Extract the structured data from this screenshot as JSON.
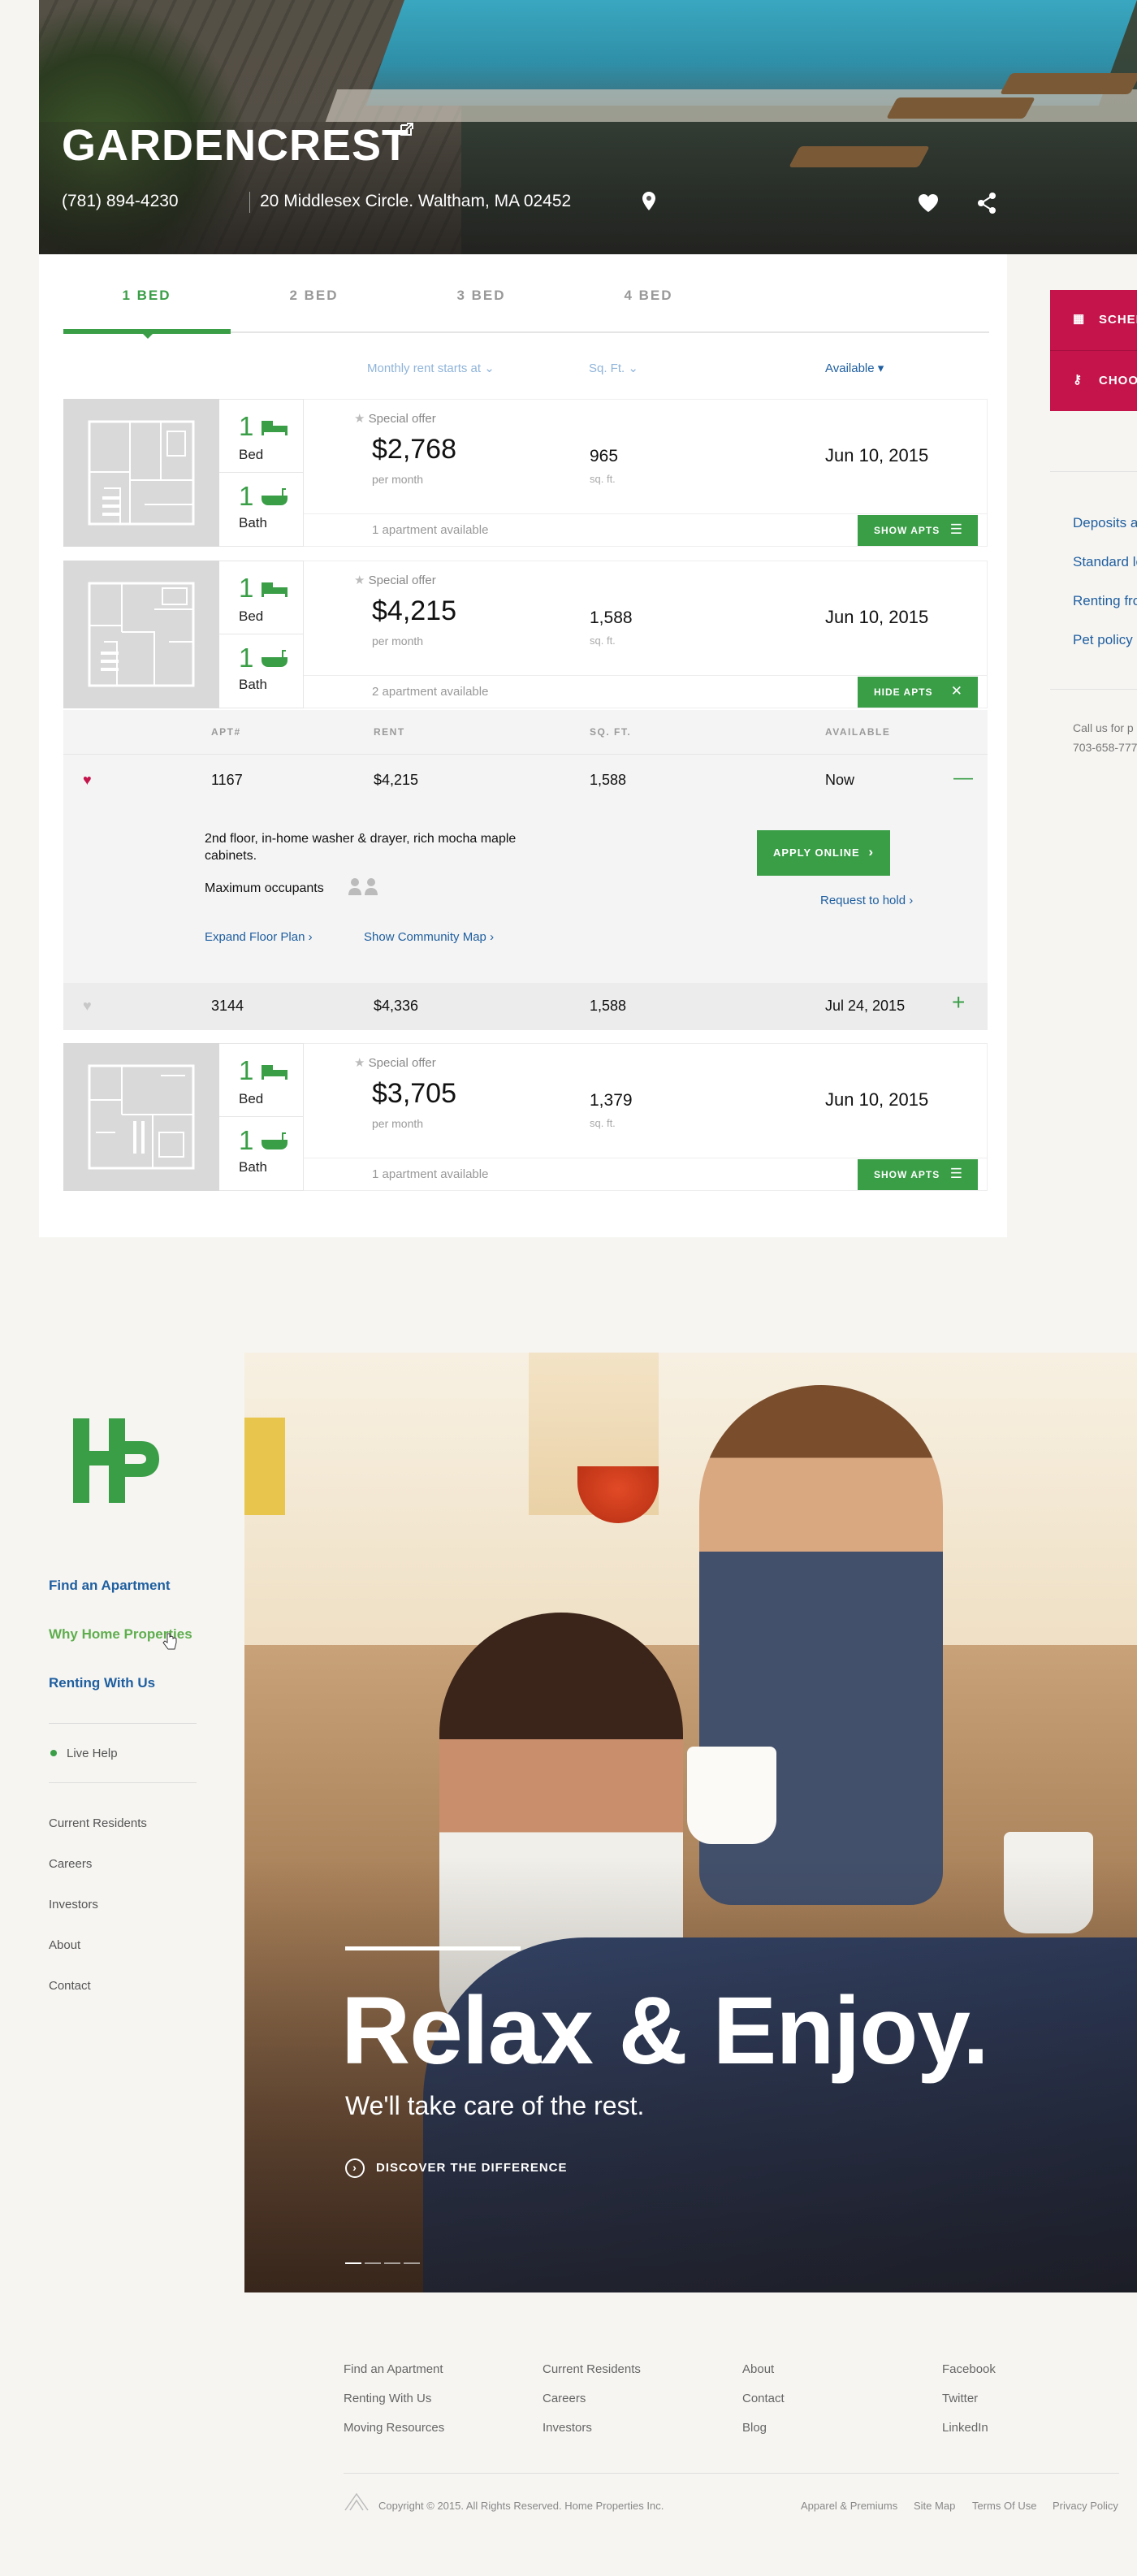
{
  "property": {
    "name": "GARDENCREST",
    "phone": "(781) 894-4230",
    "address": "20 Middlesex Circle. Waltham, MA 02452"
  },
  "tabs": [
    "1 BED",
    "2 BED",
    "3 BED",
    "4 BED"
  ],
  "columns": {
    "rent": "Monthly rent starts at",
    "sqft": "Sq. Ft.",
    "available": "Available"
  },
  "units": [
    {
      "beds": "1",
      "bed_label": "Bed",
      "baths": "1",
      "bath_label": "Bath",
      "offer": "Special offer",
      "price": "$2,768",
      "per": "per month",
      "sqft": "965",
      "sqft_label": "sq. ft.",
      "available": "Jun 10, 2015",
      "count": "1 apartment available",
      "button": "SHOW APTS"
    },
    {
      "beds": "1",
      "bed_label": "Bed",
      "baths": "1",
      "bath_label": "Bath",
      "offer": "Special offer",
      "price": "$4,215",
      "per": "per month",
      "sqft": "1,588",
      "sqft_label": "sq. ft.",
      "available": "Jun 10, 2015",
      "count": "2 apartment available",
      "button": "HIDE APTS"
    },
    {
      "beds": "1",
      "bed_label": "Bed",
      "baths": "1",
      "bath_label": "Bath",
      "offer": "Special offer",
      "price": "$3,705",
      "per": "per month",
      "sqft": "1,379",
      "sqft_label": "sq. ft.",
      "available": "Jun 10, 2015",
      "count": "1 apartment available",
      "button": "SHOW APTS"
    }
  ],
  "apt_table": {
    "headers": [
      "APT#",
      "RENT",
      "SQ. FT.",
      "AVAILABLE"
    ],
    "rows": [
      {
        "apt": "1167",
        "rent": "$4,215",
        "sqft": "1,588",
        "available": "Now",
        "toggle": "—"
      },
      {
        "apt": "3144",
        "rent": "$4,336",
        "sqft": "1,588",
        "available": "Jul 24, 2015",
        "toggle": "+"
      }
    ],
    "description": "2nd floor, in-home washer & drayer, rich mocha maple cabinets.",
    "max_occupants": "Maximum occupants",
    "apply": "APPLY ONLINE",
    "hold": "Request to hold",
    "floorplan": "Expand Floor Plan",
    "map": "Show Community Map"
  },
  "sidebar": {
    "schedule": "SCHEDULE",
    "choose": "CHOOSE",
    "links": [
      "Deposits and",
      "Standard le",
      "Renting fro",
      "Pet policy"
    ],
    "call_line1": "Call us for p",
    "call_line2": "703-658-777"
  },
  "nav": {
    "main": [
      "Find an Apartment",
      "Why Home Properties",
      "Renting With Us"
    ],
    "live_help": "Live Help",
    "secondary": [
      "Current Residents",
      "Careers",
      "Investors",
      "About",
      "Contact"
    ]
  },
  "banner": {
    "headline": "Relax & Enjoy.",
    "subline": "We'll take care of the rest.",
    "cta": "DISCOVER THE DIFFERENCE"
  },
  "footer": {
    "col1": [
      "Find an Apartment",
      "Renting With Us",
      "Moving Resources"
    ],
    "col2": [
      "Current Residents",
      "Careers",
      "Investors"
    ],
    "col3": [
      "About",
      "Contact",
      "Blog"
    ],
    "col4": [
      "Facebook",
      "Twitter",
      "LinkedIn"
    ],
    "copyright": "Copyright © 2015. All Rights Reserved. Home Properties Inc.",
    "legal": [
      "Apparel & Premiums",
      "Site Map",
      "Terms Of Use",
      "Privacy Policy"
    ]
  },
  "colors": {
    "green": "#3a9e47",
    "blue": "#1f5fa0",
    "red": "#c4144b"
  }
}
